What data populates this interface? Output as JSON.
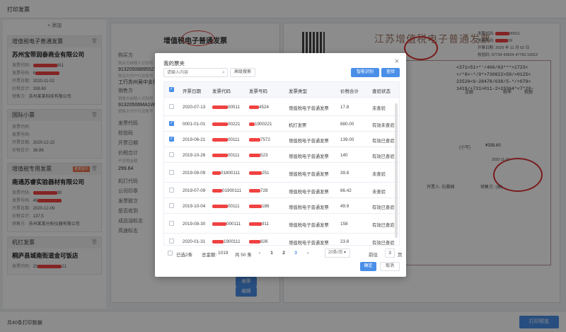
{
  "page": {
    "title": "打印发票"
  },
  "sidebar": {
    "add_label": "+ 添加",
    "cards": [
      {
        "type": "增值税电子普通发票",
        "company": "苏州宝带润泰商业有限公司",
        "code_label": "发票代码:",
        "code_suffix": "911",
        "number_label": "发票号码:",
        "number_prefix": "6",
        "date_label": "开票日期:",
        "date": "2020-11-02",
        "amount_label": "价税合计:",
        "amount": "338.60",
        "seller_label": "销售方:",
        "seller": "苏州某某科技有限公司"
      },
      {
        "type": "国际小票",
        "code_label": "发票代码:",
        "number_label": "发票号码:",
        "date_label": "开票日期:",
        "date": "2020-12-22",
        "amount_label": "价税合计:",
        "amount": "38.86"
      },
      {
        "type": "增值税专用发票",
        "tag": "重复提示",
        "company": "南通苏睿实验器材有限公司",
        "code_label": "发票代码:",
        "code_suffix": "30",
        "number_label": "发票号码:",
        "number_prefix": "45",
        "date_label": "开票日期:",
        "date": "2020-12-09",
        "amount_label": "价税合计:",
        "amount": "137.5",
        "seller_label": "销售方:",
        "seller": "苏州某某分析仪器有限公司"
      },
      {
        "type": "机打发票",
        "company": "桐庐县城南街道金可饭店",
        "code_label": "发票代码:",
        "code_prefix": "23",
        "code_suffix": "21"
      }
    ]
  },
  "bottom": {
    "summary": "共40条打印数据",
    "print_label": "打印预览"
  },
  "invoice_left": {
    "title": "增值税电子普通发票",
    "buyer_label": "购买方",
    "buyer_hint1": "购买方纳税人识别号",
    "buyer_code": "91320508895527-",
    "buyer_bank_hint": "购买方开户行及账号",
    "buyer_bank": "工行苏州吴中支行",
    "seller_label": "销售方",
    "seller_hint": "销售方纳税人识别号",
    "seller_code": "91320506MA1WW",
    "seller_bank_hint": "销售方开户行及账号",
    "fields": [
      "发票代码",
      "校验码",
      "开票日期",
      "价税合计"
    ],
    "total_hint": "不含税金额",
    "total_value": "299.64",
    "fields2": [
      "机打代码",
      "公司印章",
      "发票联次",
      "是否收到",
      "成品油标志",
      "高速标志"
    ],
    "btn1": "报票",
    "btn2": "编辑"
  },
  "invoice_right": {
    "title": "江苏增值税电子普通发票",
    "code_label": "发票代码:",
    "code_suffix": "00011",
    "number_label": "发票号码:",
    "number_suffix": "09",
    "date_label": "开票日期:",
    "date": "2020 年 11 月 02 日",
    "check_label": "校验码:",
    "check": "07734 43624 47783 16912",
    "code_lines": [
      "<371<51+*'/466/63***>1723<",
      "+/*8<~*/9*>730822>59/>0125<",
      "22526<6~28478/638/5-*/+079>",
      "1419/+731>011-2>19364*<7*20~"
    ],
    "col_amount": "金额",
    "col_rate": "税率",
    "col_tax": "税额",
    "small_label": "(小写)",
    "small_value": "¥338.60",
    "note_label": "开票人:",
    "note_person": "石雅楠",
    "seller_label": "销售方: (章)",
    "date_small": "2020-11-02"
  },
  "modal": {
    "title": "我的票夹",
    "search_placeholder": "请输入内容",
    "adv_search": "高级搜索",
    "smart_btn": "智能识别",
    "check_btn": "查验",
    "columns": [
      "开票日期",
      "发票代码",
      "发票号码",
      "发票类型",
      "价税合计",
      "查验状态"
    ],
    "rows": [
      {
        "checked": false,
        "date": "2020-07-13",
        "code": "00511",
        "number": "4524",
        "type": "增值税电子普通发票",
        "amount": "17.8",
        "status": "未查验"
      },
      {
        "checked": true,
        "date": "0001-01-01",
        "code": "00221",
        "number": "1900221",
        "type": "机打发票",
        "amount": "880.00",
        "status": "有效未查验"
      },
      {
        "checked": true,
        "date": "2019-06-21",
        "code": "00111",
        "number": "7572",
        "type": "增值税电子普通发票",
        "amount": "139.00",
        "status": "有效已查验"
      },
      {
        "checked": false,
        "date": "2019-10-26",
        "code": "00111",
        "number": "523",
        "type": "增值税电子普通发票",
        "amount": "140",
        "status": "有效已查验"
      },
      {
        "checked": false,
        "date": "2019-08-09",
        "code": "01800111",
        "number": "251",
        "type": "增值税电子普通发票",
        "amount": "39.8",
        "status": "未查验"
      },
      {
        "checked": false,
        "date": "2019-07-09",
        "code": "01900111",
        "number": "728",
        "type": "增值税电子普通发票",
        "amount": "66.42",
        "status": "未查验"
      },
      {
        "checked": false,
        "date": "2019-10-04",
        "code": "00111",
        "number": "186",
        "type": "增值税电子普通发票",
        "amount": "49.9",
        "status": "有效已查验"
      },
      {
        "checked": false,
        "date": "2019-08-30",
        "code": "000111",
        "number": "911",
        "type": "增值税电子普通发票",
        "amount": "158",
        "status": "有效已查验"
      },
      {
        "checked": false,
        "date": "2020-01-31",
        "code": "1900111",
        "number": "826",
        "type": "增值税电子普通发票",
        "amount": "23.8",
        "status": "有效已查验"
      }
    ],
    "selected": "已选2条",
    "total_label": "总金额:",
    "total_value": "1019",
    "count": "共 50 条",
    "pages": [
      "1",
      "2",
      "3"
    ],
    "current_page": "2",
    "per_page": "20条/页",
    "goto_label": "前往",
    "goto_value": "3",
    "page_suffix": "页",
    "ok": "确定",
    "cancel": "取消"
  }
}
